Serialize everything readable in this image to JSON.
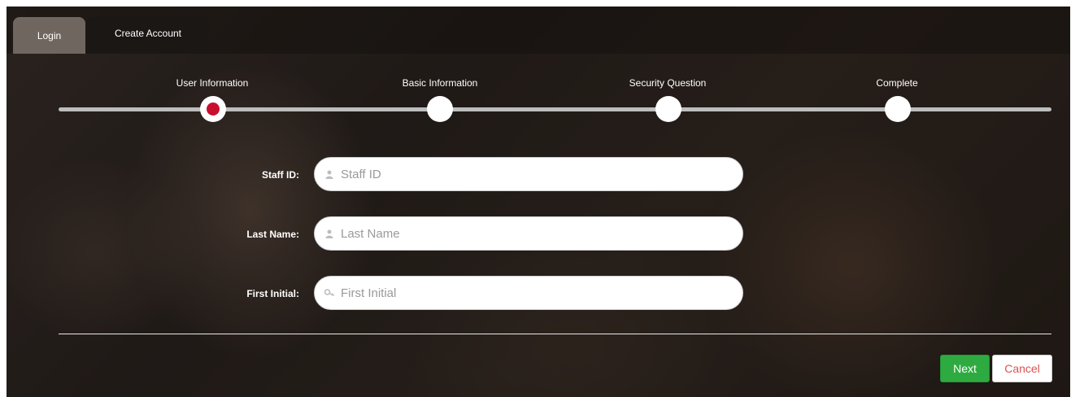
{
  "tabs": {
    "login_label": "Login",
    "create_account_label": "Create Account"
  },
  "wizard": {
    "steps": [
      {
        "label": "User Information",
        "active": true
      },
      {
        "label": "Basic Information",
        "active": false
      },
      {
        "label": "Security Question",
        "active": false
      },
      {
        "label": "Complete",
        "active": false
      }
    ],
    "active_step_color": "#c8102e"
  },
  "form": {
    "staff_id": {
      "label": "Staff ID:",
      "placeholder": "Staff ID",
      "value": "",
      "icon": "user-icon"
    },
    "last_name": {
      "label": "Last Name:",
      "placeholder": "Last Name",
      "value": "",
      "icon": "user-icon"
    },
    "first_initial": {
      "label": "First Initial:",
      "placeholder": "First Initial",
      "value": "",
      "icon": "key-icon"
    }
  },
  "actions": {
    "next_label": "Next",
    "cancel_label": "Cancel",
    "next_color": "#2eab40",
    "cancel_text_color": "#d9534f"
  }
}
